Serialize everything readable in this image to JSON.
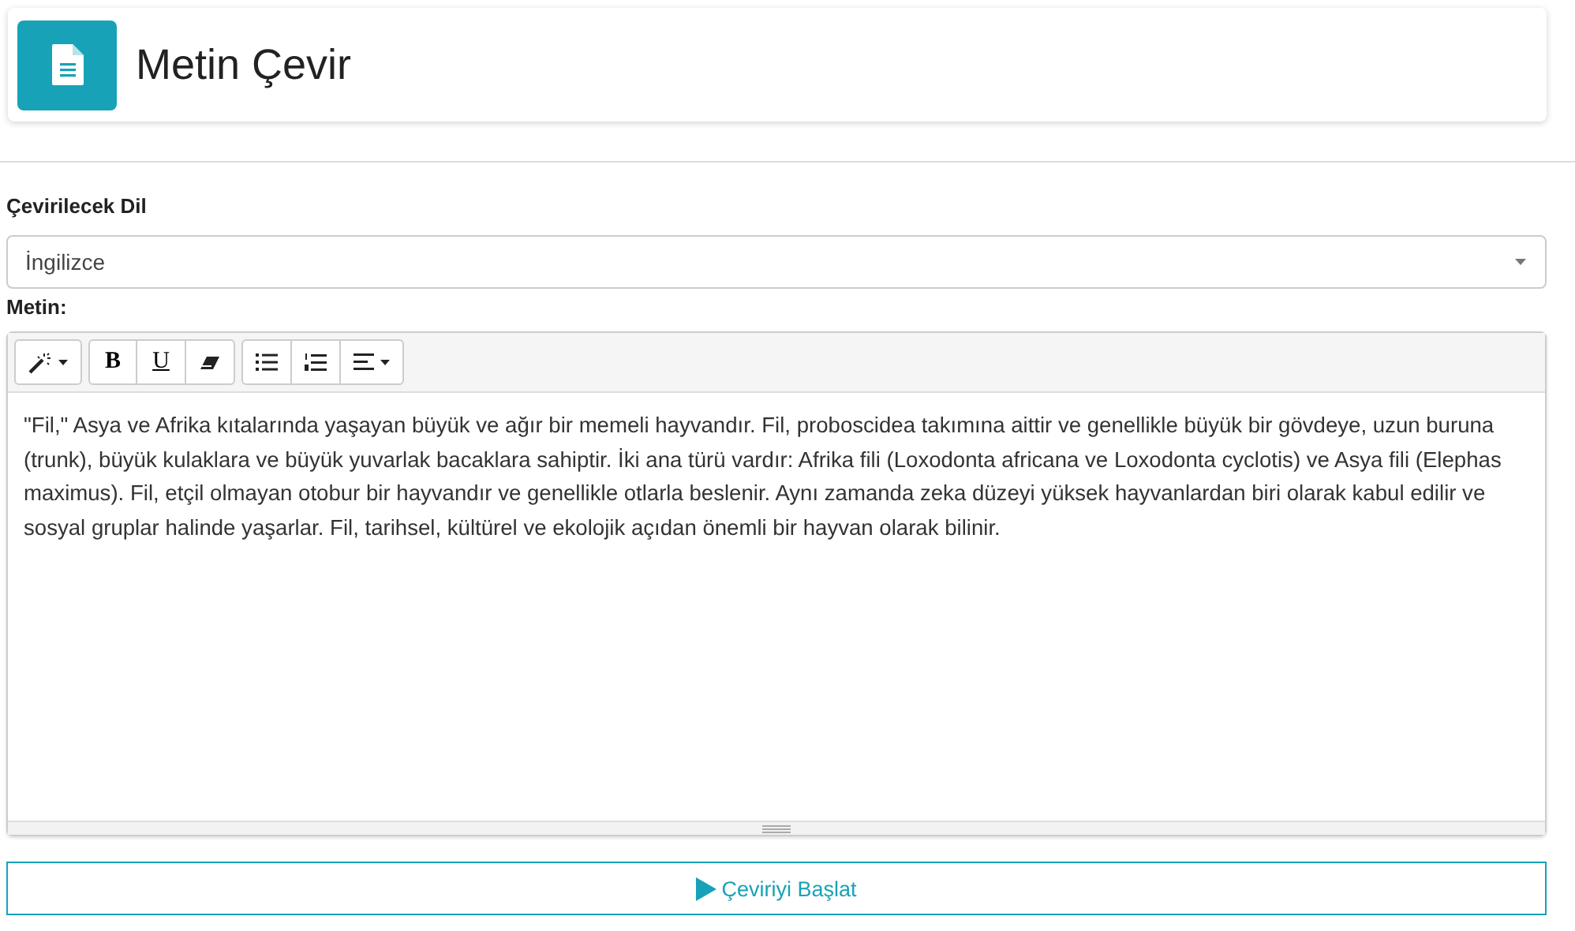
{
  "header": {
    "title": "Metin Çevir"
  },
  "language": {
    "label": "Çevirilecek Dil",
    "value": "İngilizce"
  },
  "editor": {
    "label": "Metin:",
    "toolbar": [
      [
        {
          "kind": "magic",
          "dropdown": true
        }
      ],
      [
        {
          "kind": "bold",
          "label": "B"
        },
        {
          "kind": "underline",
          "label": "U"
        },
        {
          "kind": "eraser"
        }
      ],
      [
        {
          "kind": "ul"
        },
        {
          "kind": "ol"
        },
        {
          "kind": "align",
          "dropdown": true
        }
      ]
    ],
    "text": "\"Fil,\" Asya ve Afrika kıtalarında yaşayan büyük ve ağır bir memeli hayvandır. Fil, proboscidea takımına aittir ve genellikle büyük bir gövdeye, uzun buruna (trunk), büyük kulaklara ve büyük yuvarlak bacaklara sahiptir. İki ana türü vardır: Afrika fili (Loxodonta africana ve Loxodonta cyclotis) ve Asya fili (Elephas maximus). Fil, etçil olmayan otobur bir hayvandır ve genellikle otlarla beslenir. Aynı zamanda zeka düzeyi yüksek hayvanlardan biri olarak kabul edilir ve sosyal gruplar halinde yaşarlar. Fil, tarihsel, kültürel ve ekolojik açıdan önemli bir hayvan olarak bilinir."
  },
  "button": {
    "label": "Çeviriyi Başlat"
  }
}
